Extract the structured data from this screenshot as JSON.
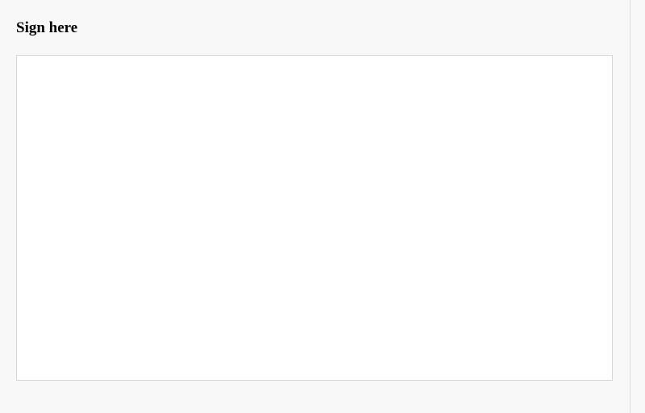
{
  "header": {
    "title": "Sign here"
  }
}
